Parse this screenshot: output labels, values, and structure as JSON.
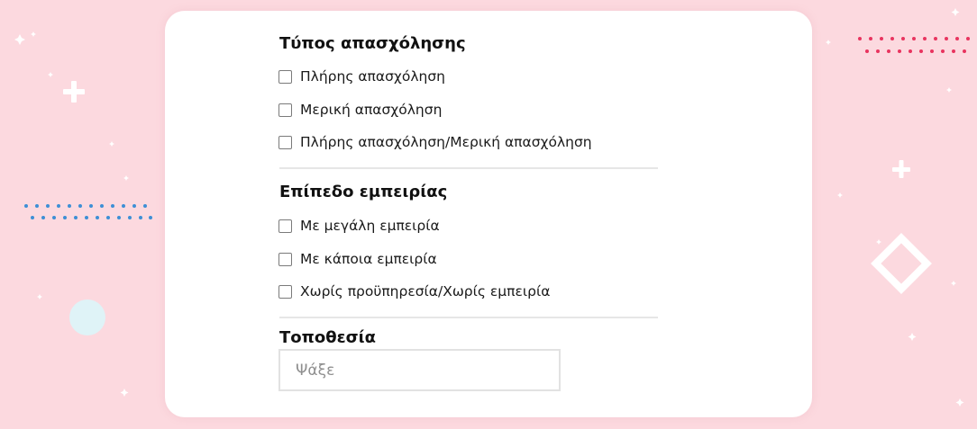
{
  "filters": {
    "employment_type": {
      "title": "Τύπος απασχόλησης",
      "options": [
        {
          "label": "Πλήρης απασχόληση",
          "checked": false
        },
        {
          "label": "Μερική απασχόληση",
          "checked": false
        },
        {
          "label": "Πλήρης απασχόληση/Μερική απασχόληση",
          "checked": false
        }
      ]
    },
    "experience_level": {
      "title": "Επίπεδο εμπειρίας",
      "options": [
        {
          "label": "Με μεγάλη εμπειρία",
          "checked": false
        },
        {
          "label": "Με κάποια εμπειρία",
          "checked": false
        },
        {
          "label": "Χωρίς προϋπηρεσία/Χωρίς εμπειρία",
          "checked": false
        }
      ]
    },
    "location": {
      "title": "Τοποθεσία",
      "search_value": "",
      "search_placeholder": "Ψάξε"
    }
  },
  "colors": {
    "background": "#fcd9df",
    "card": "#ffffff",
    "dots_blue": "#3d8fd6",
    "dots_red": "#e8345f",
    "bubble": "#dff3f7"
  },
  "decorations": [
    "sparkle-icon",
    "plus-icon",
    "diamond-icon",
    "circle-bubble",
    "dotted-lines"
  ]
}
